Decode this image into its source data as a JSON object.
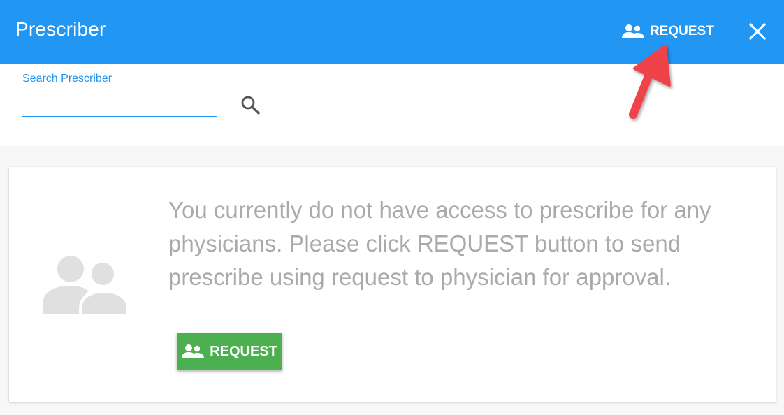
{
  "header": {
    "title": "Prescriber",
    "request_label": "REQUEST",
    "request_icon": "people-icon",
    "close_icon": "close-icon",
    "background_color": "#2196f3"
  },
  "search": {
    "label": "Search Prescriber",
    "value": "",
    "placeholder": "",
    "icon": "search-icon"
  },
  "empty_state": {
    "icon": "people-icon",
    "message": "You currently do not have access to prescribe for any physicians. Please click REQUEST button to send prescribe using request to physician for approval.",
    "request_label": "REQUEST",
    "button_color": "#4caf50"
  },
  "annotation": {
    "arrow_color": "#f0424a"
  }
}
